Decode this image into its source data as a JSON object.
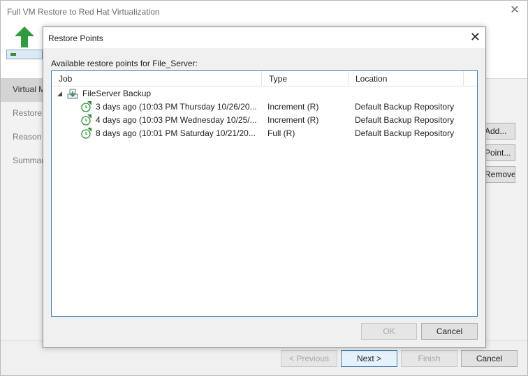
{
  "wizard": {
    "title": "Full VM Restore to Red Hat Virtualization",
    "close_glyph": "✕",
    "steps": [
      {
        "label": "Virtual Machines",
        "active": true
      },
      {
        "label": "Restore Mode",
        "active": false
      },
      {
        "label": "Reason",
        "active": false
      },
      {
        "label": "Summary",
        "active": false
      }
    ],
    "side_buttons": {
      "add": "Add...",
      "point": "Point...",
      "remove": "Remove"
    },
    "footer": {
      "previous": "< Previous",
      "next": "Next >",
      "finish": "Finish",
      "cancel": "Cancel"
    }
  },
  "dialog": {
    "title": "Restore Points",
    "close_glyph": "✕",
    "label": "Available restore points for File_Server:",
    "columns": {
      "job": "Job",
      "type": "Type",
      "location": "Location"
    },
    "job_name": "FileServer Backup",
    "restore_points": [
      {
        "job": "3 days ago (10:03 PM Thursday 10/26/20...",
        "type": "Increment (R)",
        "location": "Default Backup Repository"
      },
      {
        "job": "4 days ago (10:03 PM Wednesday 10/25/...",
        "type": "Increment (R)",
        "location": "Default Backup Repository"
      },
      {
        "job": "8 days ago (10:01 PM Saturday 10/21/20...",
        "type": "Full (R)",
        "location": "Default Backup Repository"
      }
    ],
    "ok": "OK",
    "cancel": "Cancel"
  },
  "colors": {
    "accent_green": "#2f8f3a",
    "focus_blue": "#3c7fb1"
  }
}
